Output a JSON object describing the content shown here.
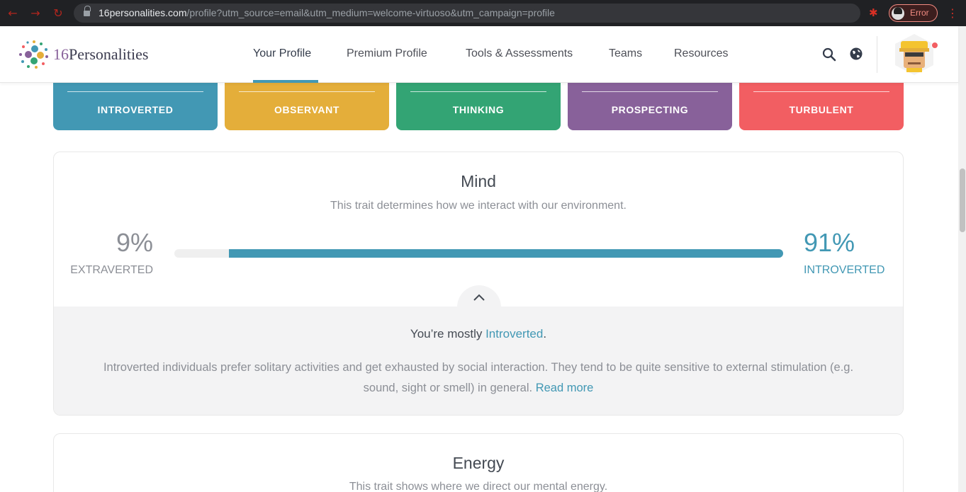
{
  "browser": {
    "url_host": "16personalities.com",
    "url_path": "/profile?utm_source=email&utm_medium=welcome-virtuoso&utm_campaign=profile",
    "profile_status": "Error"
  },
  "header": {
    "logo_number": "16",
    "logo_word": "Personalities",
    "nav": [
      {
        "label": "Your Profile",
        "active": true
      },
      {
        "label": "Premium Profile",
        "active": false
      },
      {
        "label": "Tools & Assessments",
        "active": false
      },
      {
        "label": "Teams",
        "active": false
      },
      {
        "label": "Resources",
        "active": false
      }
    ]
  },
  "traits": [
    {
      "label": "INTROVERTED",
      "color": "#4298b4"
    },
    {
      "label": "OBSERVANT",
      "color": "#e4ae3a"
    },
    {
      "label": "THINKING",
      "color": "#33a474"
    },
    {
      "label": "PROSPECTING",
      "color": "#88619a"
    },
    {
      "label": "TURBULENT",
      "color": "#f25e62"
    }
  ],
  "mind": {
    "title": "Mind",
    "subtitle": "This trait determines how we interact with our environment.",
    "left_pct": "9%",
    "left_label": "EXTRAVERTED",
    "right_pct": "91%",
    "right_label": "INTROVERTED",
    "bar_value": 0.91,
    "mostly_prefix": "You’re mostly ",
    "mostly_trait": "Introverted",
    "mostly_suffix": ".",
    "description": "Introverted individuals prefer solitary activities and get exhausted by social interaction. They tend to be quite sensitive to external stimulation (e.g. sound, sight or smell) in general. ",
    "read_more": "Read more"
  },
  "energy": {
    "title": "Energy",
    "subtitle": "This trait shows where we direct our mental energy."
  },
  "icons": {
    "back": "back-arrow-icon",
    "forward": "forward-arrow-icon",
    "reload": "reload-icon",
    "lock": "lock-icon",
    "bookmark": "star-icon",
    "extension": "puzzle-icon",
    "search": "search-icon",
    "globe": "globe-icon",
    "collapse": "chevron-up-icon"
  }
}
